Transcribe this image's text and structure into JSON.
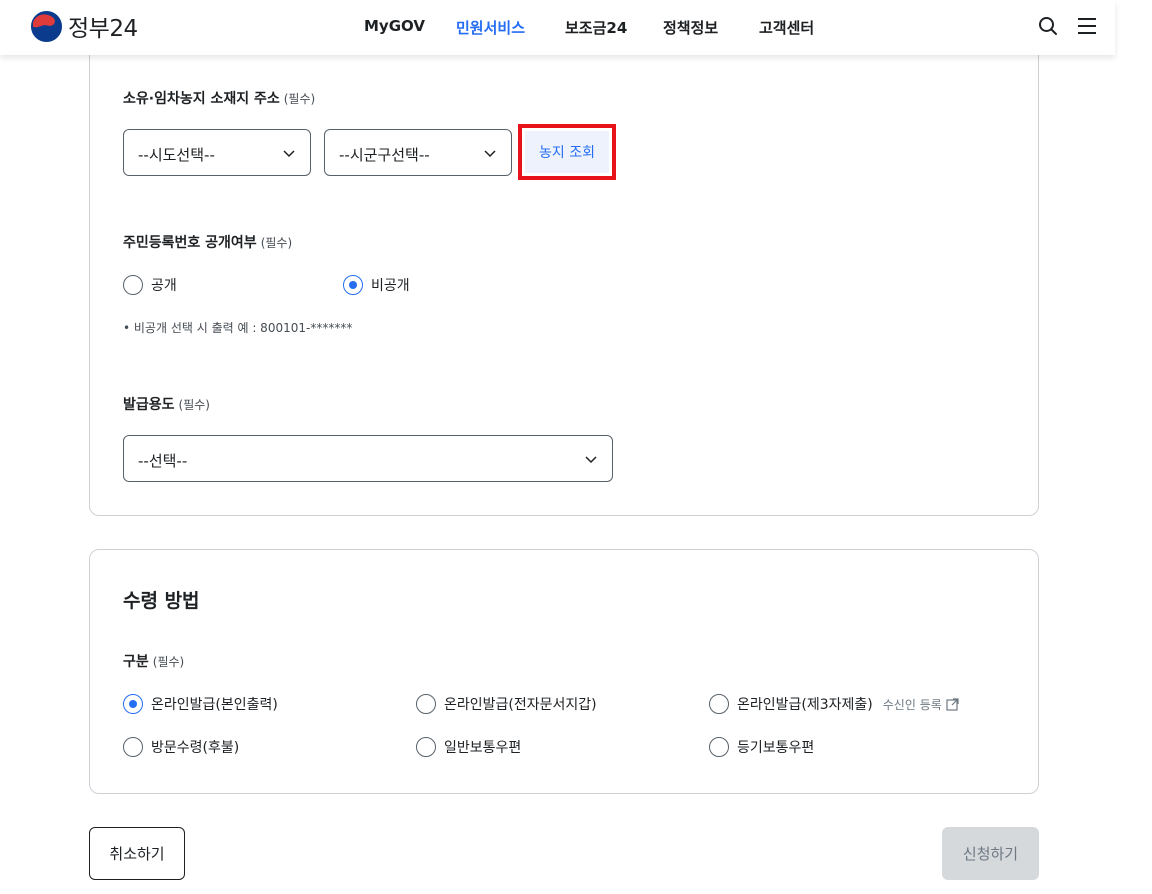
{
  "header": {
    "logo_text": "정부24",
    "nav": [
      {
        "label": "MyGOV",
        "active": false
      },
      {
        "label": "민원서비스",
        "active": true
      },
      {
        "label": "보조금24",
        "active": false
      },
      {
        "label": "정책정보",
        "active": false
      },
      {
        "label": "고객센터",
        "active": false
      }
    ],
    "icons": [
      "search-icon",
      "menu-icon"
    ],
    "accent_color": "#256ef4"
  },
  "address": {
    "label": "소유·임차농지 소재지 주소",
    "required": "(필수)",
    "sido_select": "--시도선택--",
    "sigungu_select": "--시군구선택--",
    "lookup_button": "농지 조회",
    "highlight_color": "#e8121b"
  },
  "resident_number": {
    "label": "주민등록번호 공개여부",
    "required": "(필수)",
    "options": [
      {
        "label": "공개",
        "selected": false
      },
      {
        "label": "비공개",
        "selected": true
      }
    ],
    "note": "• 비공개 선택 시 출력 예 : 800101-*******"
  },
  "purpose": {
    "label": "발급용도",
    "required": "(필수)",
    "select": "--선택--"
  },
  "receive": {
    "title": "수령 방법",
    "label": "구분",
    "required": "(필수)",
    "options": [
      {
        "label": "온라인발급(본인출력)",
        "selected": true
      },
      {
        "label": "온라인발급(전자문서지갑)",
        "selected": false
      },
      {
        "label": "온라인발급(제3자제출)",
        "selected": false
      },
      {
        "label": "방문수령(후불)",
        "selected": false
      },
      {
        "label": "일반보통우편",
        "selected": false
      },
      {
        "label": "등기보통우편",
        "selected": false
      }
    ],
    "register_link": "수신인 등록"
  },
  "actions": {
    "cancel": "취소하기",
    "apply": "신청하기"
  }
}
